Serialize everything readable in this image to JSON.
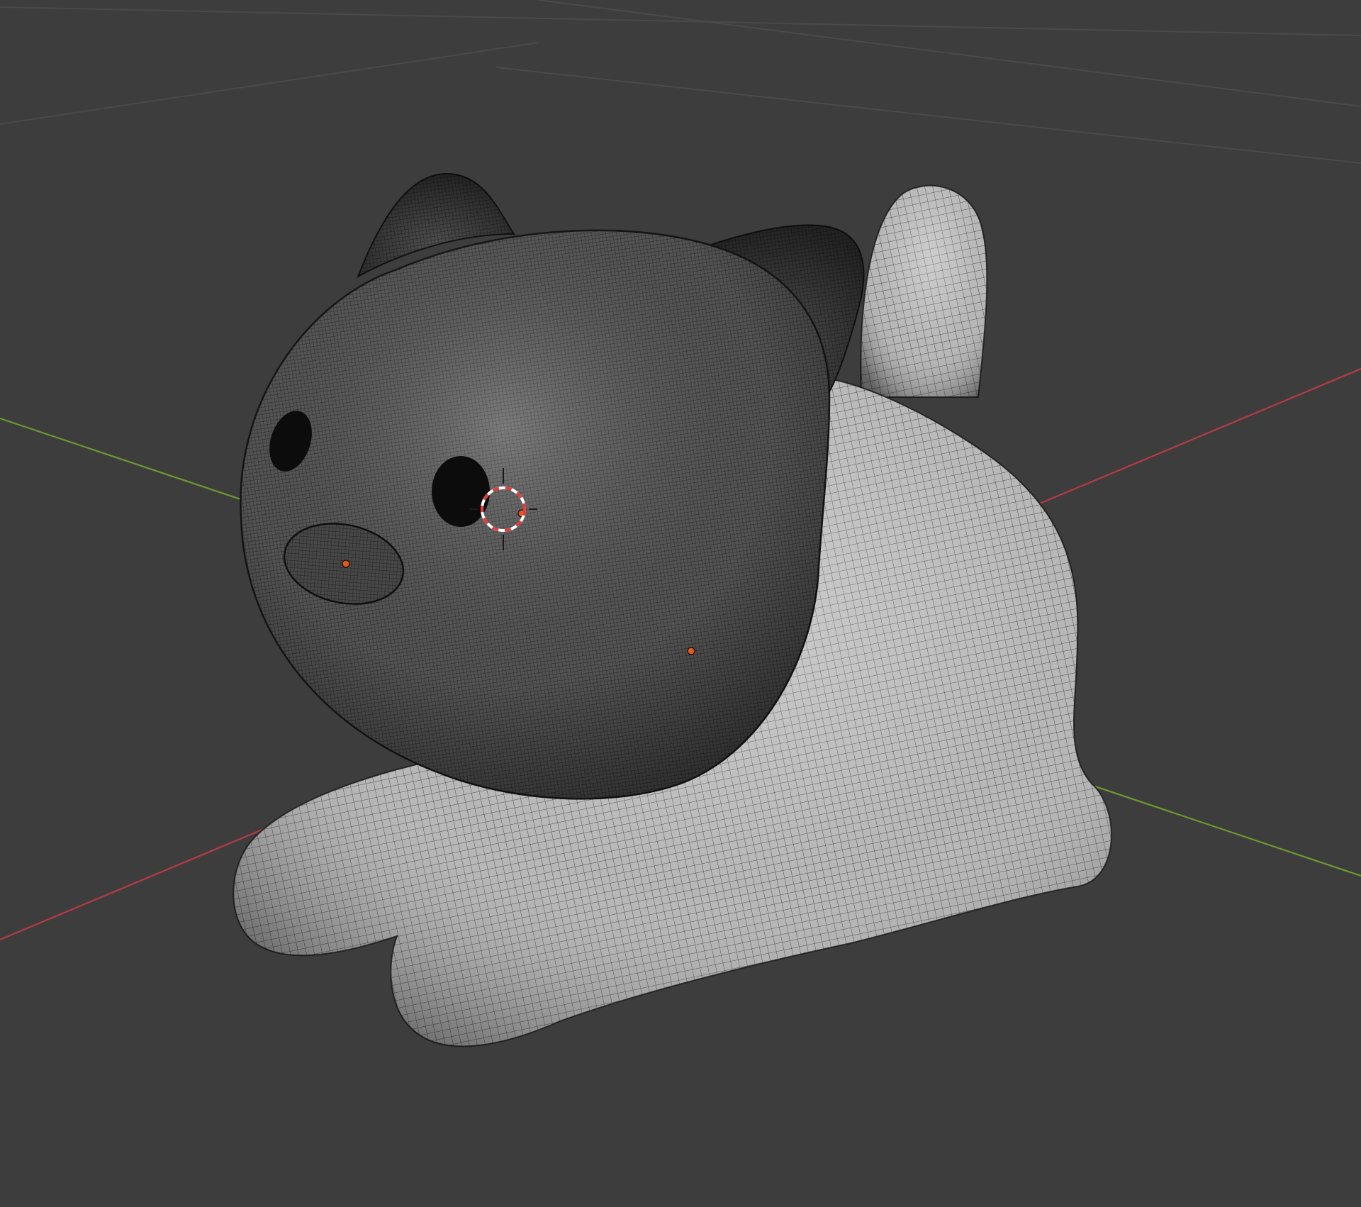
{
  "viewport": {
    "background": "#3d3d3d",
    "grid_color": "#4a4a4a",
    "x_axis_color": "#b43b45",
    "y_axis_color": "#6c9a2e",
    "object_origin_color": "#e05a1a",
    "cursor_colors": [
      "#e23b3b",
      "#ffffff"
    ]
  },
  "scene_object": {
    "name_icon": "cat-mesh",
    "body_color": "#a8a8a8",
    "head_color": "#4c4c4c",
    "wireframe": true,
    "shading": "solid"
  },
  "icons": {
    "cursor": "3d-cursor-icon",
    "origin": "object-origin-icon"
  }
}
